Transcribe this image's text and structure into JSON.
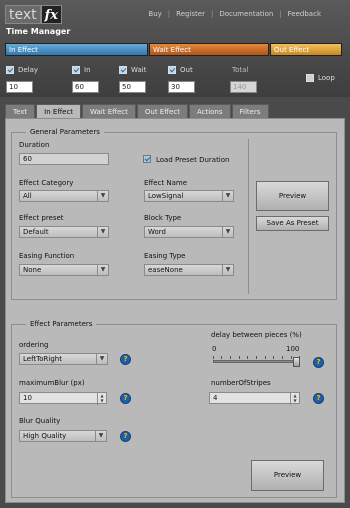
{
  "app": {
    "logo_text": "text",
    "logo_fx": "fx",
    "title": "Time Manager",
    "nav": [
      "Buy",
      "Register",
      "Documentation",
      "Feedback"
    ]
  },
  "timeline": {
    "bars": [
      "In Effect",
      "Wait Effect",
      "Out Effect"
    ],
    "colors": {
      "in": "#2f78ad",
      "wait": "#b0541a",
      "out": "#c9881e"
    }
  },
  "timing": {
    "delay": {
      "label": "Delay",
      "value": "10",
      "checked": true
    },
    "in": {
      "label": "In",
      "value": "60",
      "checked": true
    },
    "wait": {
      "label": "Wait",
      "value": "50",
      "checked": true
    },
    "out": {
      "label": "Out",
      "value": "30",
      "checked": true
    },
    "total": {
      "label": "Total",
      "value": "140"
    },
    "loop": {
      "label": "Loop",
      "checked": false
    }
  },
  "tabs": [
    "Text",
    "In Effect",
    "Wait Effect",
    "Out Effect",
    "Actions",
    "Filters"
  ],
  "active_tab": "In Effect",
  "general": {
    "legend": "General Parameters",
    "duration_label": "Duration",
    "duration_value": "60",
    "load_preset_label": "Load Preset Duration",
    "effect_category_label": "Effect Category",
    "effect_category_value": "All",
    "effect_name_label": "Effect Name",
    "effect_name_value": "LowSignal",
    "effect_preset_label": "Effect preset",
    "effect_preset_value": "Default",
    "block_type_label": "Block Type",
    "block_type_value": "Word",
    "easing_function_label": "Easing Function",
    "easing_function_value": "None",
    "easing_type_label": "Easing Type",
    "easing_type_value": "easeNone",
    "preview_label": "Preview",
    "save_preset_label": "Save As Preset"
  },
  "effect_params": {
    "legend": "Effect Parameters",
    "ordering_label": "ordering",
    "ordering_value": "LeftToRight",
    "delay_label": "delay between pieces (%)",
    "slider_min": "0",
    "slider_max": "100",
    "slider_value": 100,
    "max_blur_label": "maximumBlur (px)",
    "max_blur_value": "10",
    "stripes_label": "numberOfStripes",
    "stripes_value": "4",
    "blur_quality_label": "Blur Quality",
    "blur_quality_value": "High Quality",
    "help_glyph": "?",
    "preview_label": "Preview"
  }
}
